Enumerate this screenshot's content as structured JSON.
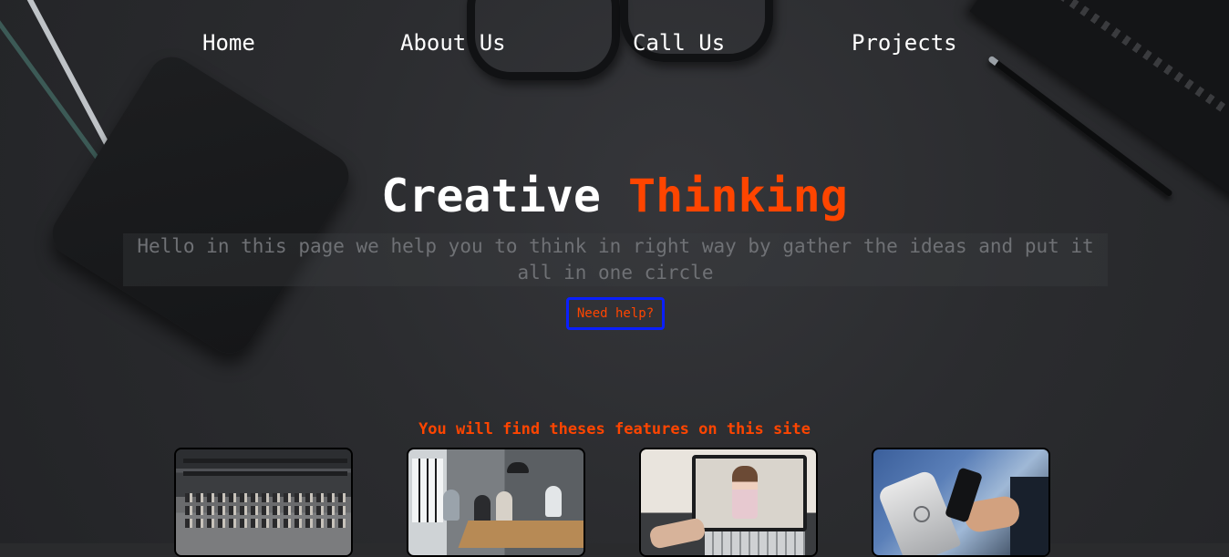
{
  "nav": {
    "items": [
      {
        "label": "Home"
      },
      {
        "label": "About Us"
      },
      {
        "label": "Call Us"
      },
      {
        "label": "Projects"
      }
    ]
  },
  "hero": {
    "title_main": "Creative",
    "title_accent": "Thinking",
    "tagline": "Hello in this page we help you to think in right way by gather the ideas and put it all in one circle",
    "help_button": "Need help?"
  },
  "features": {
    "title": "You will find theses features on this site",
    "cards": [
      {
        "image": "open-office-photo"
      },
      {
        "image": "team-meeting-photo"
      },
      {
        "image": "video-call-photo"
      },
      {
        "image": "mobile-payment-photo"
      }
    ]
  },
  "colors": {
    "accent": "#ff4500",
    "button_border": "#0a1fff",
    "background": "#2a2b2d",
    "text": "#ffffff",
    "muted_text": "#6f7175"
  }
}
